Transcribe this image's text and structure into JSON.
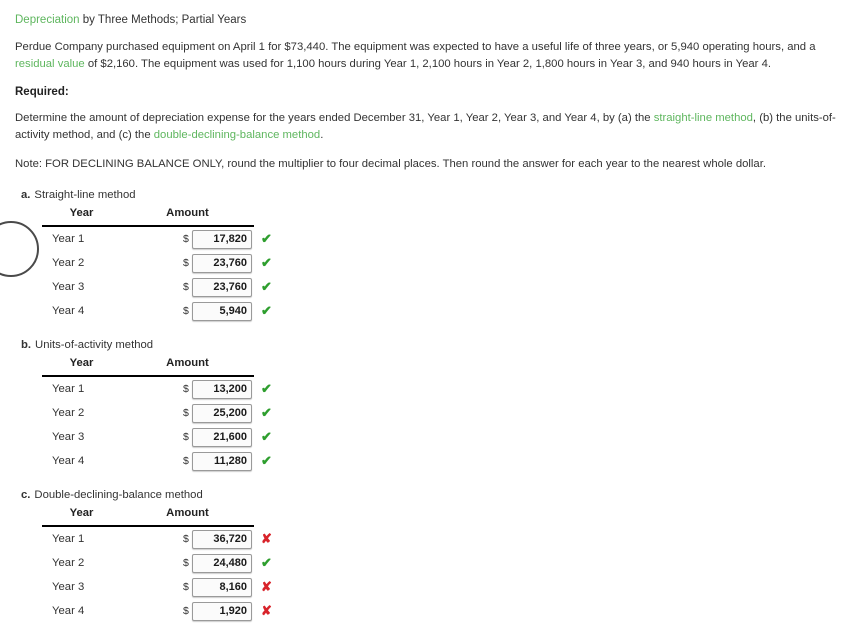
{
  "problem": {
    "title_link": "Depreciation",
    "title_rest": " by Three Methods; Partial Years",
    "body_1": "Perdue Company purchased equipment on April 1 for $73,440. The equipment was expected to have a useful life of three years, or 5,940 operating hours, and a ",
    "body_1_link": "residual value",
    "body_2": " of $2,160. The equipment was used for 1,100 hours during Year 1, 2,100 hours in Year 2, 1,800 hours in Year 3, and 940 hours in Year 4.",
    "required_label": "Required:",
    "instructions_1": "Determine the amount of depreciation expense for the years ended December 31, Year 1, Year 2, Year 3, and Year 4, by (a) the ",
    "instructions_link_1": "straight-line method",
    "instructions_2": ", (b) the units-of-activity method, and (c) the ",
    "instructions_link_2": "double-declining-balance method",
    "instructions_3": ".",
    "note": "Note: FOR DECLINING BALANCE ONLY, round the multiplier to four decimal places. Then round the answer for each year to the nearest whole dollar."
  },
  "colors": {
    "link_green": "#5eb65e",
    "correct_green": "#2e9e2e",
    "wrong_red": "#d8232a"
  },
  "columns": {
    "year": "Year",
    "amount": "Amount"
  },
  "currency_symbol": "$",
  "icons": {
    "correct": "✔",
    "wrong": "✘"
  },
  "sections": [
    {
      "letter": "a.",
      "label": "Straight-line method",
      "rows": [
        {
          "year": "Year 1",
          "amount": "17,820",
          "status": "correct"
        },
        {
          "year": "Year 2",
          "amount": "23,760",
          "status": "correct"
        },
        {
          "year": "Year 3",
          "amount": "23,760",
          "status": "correct"
        },
        {
          "year": "Year 4",
          "amount": "5,940",
          "status": "correct"
        }
      ]
    },
    {
      "letter": "b.",
      "label": "Units-of-activity method",
      "rows": [
        {
          "year": "Year 1",
          "amount": "13,200",
          "status": "correct"
        },
        {
          "year": "Year 2",
          "amount": "25,200",
          "status": "correct"
        },
        {
          "year": "Year 3",
          "amount": "21,600",
          "status": "correct"
        },
        {
          "year": "Year 4",
          "amount": "11,280",
          "status": "correct"
        }
      ]
    },
    {
      "letter": "c.",
      "label": "Double-declining-balance method",
      "rows": [
        {
          "year": "Year 1",
          "amount": "36,720",
          "status": "wrong"
        },
        {
          "year": "Year 2",
          "amount": "24,480",
          "status": "correct"
        },
        {
          "year": "Year 3",
          "amount": "8,160",
          "status": "wrong"
        },
        {
          "year": "Year 4",
          "amount": "1,920",
          "status": "wrong"
        }
      ]
    }
  ]
}
